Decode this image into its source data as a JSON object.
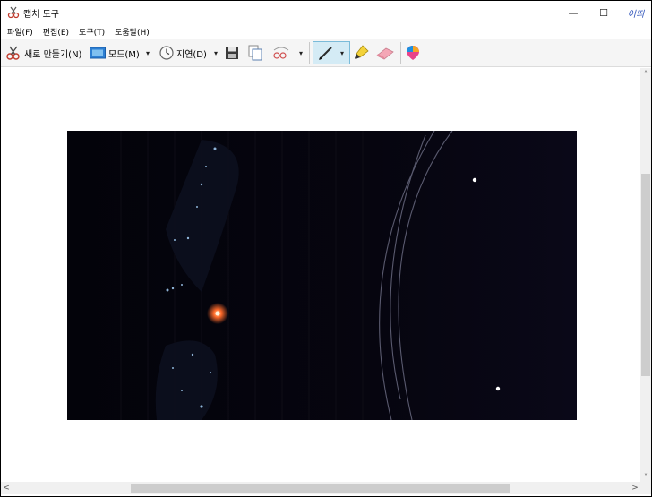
{
  "window": {
    "title": "캡처 도구",
    "controls": {
      "minimize": "—",
      "maximize": "☐",
      "close": "어띄"
    }
  },
  "menu": [
    {
      "label": "파일(F)"
    },
    {
      "label": "편집(E)"
    },
    {
      "label": "도구(T)"
    },
    {
      "label": "도움말(H)"
    }
  ],
  "toolbar": {
    "new_label": "새로 만들기(N)",
    "mode_label": "모드(M)",
    "delay_label": "지연(D)",
    "dropdown_glyph": "▾"
  },
  "scroll": {
    "up": "˄",
    "down": "˅",
    "left": "<",
    "right": ">"
  },
  "colors": {
    "accent_pen_bg": "#d4ebf5",
    "capture_bg": "#05040b",
    "star": "#ffffff",
    "glow": "#ff7a3a"
  }
}
